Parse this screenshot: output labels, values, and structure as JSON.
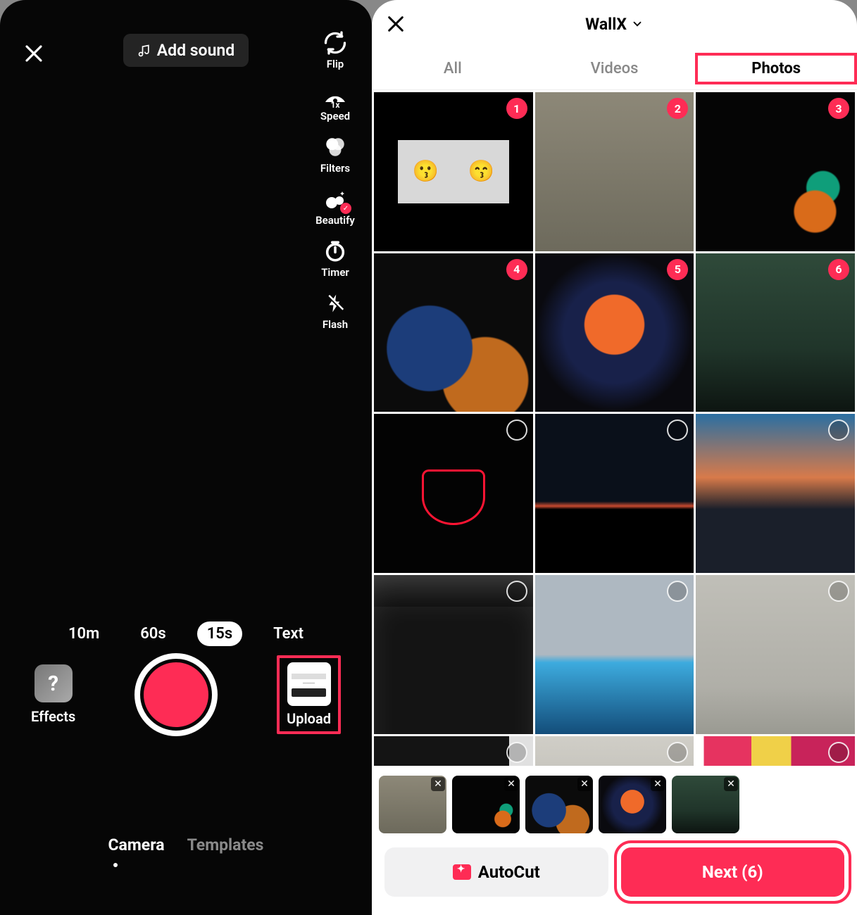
{
  "camera": {
    "add_sound_label": "Add sound",
    "tools": {
      "flip": "Flip",
      "speed": "Speed",
      "speed_value": "1x",
      "filters": "Filters",
      "beautify": "Beautify",
      "timer": "Timer",
      "flash": "Flash"
    },
    "durations": [
      "10m",
      "60s",
      "15s",
      "Text"
    ],
    "active_duration": "15s",
    "effects_label": "Effects",
    "upload_label": "Upload",
    "bottom_tabs": [
      "Camera",
      "Templates"
    ],
    "active_bottom_tab": "Camera"
  },
  "picker": {
    "album_name": "WallX",
    "tabs": [
      "All",
      "Videos",
      "Photos"
    ],
    "active_tab": "Photos",
    "grid": [
      {
        "selected": true,
        "order": 1
      },
      {
        "selected": true,
        "order": 2
      },
      {
        "selected": true,
        "order": 3
      },
      {
        "selected": true,
        "order": 4
      },
      {
        "selected": true,
        "order": 5
      },
      {
        "selected": true,
        "order": 6
      },
      {
        "selected": false
      },
      {
        "selected": false
      },
      {
        "selected": false
      },
      {
        "selected": false
      },
      {
        "selected": false
      },
      {
        "selected": false
      },
      {
        "selected": false
      },
      {
        "selected": false
      },
      {
        "selected": false
      }
    ],
    "selected_count": 6,
    "autocut_label": "AutoCut",
    "next_label": "Next (6)"
  }
}
